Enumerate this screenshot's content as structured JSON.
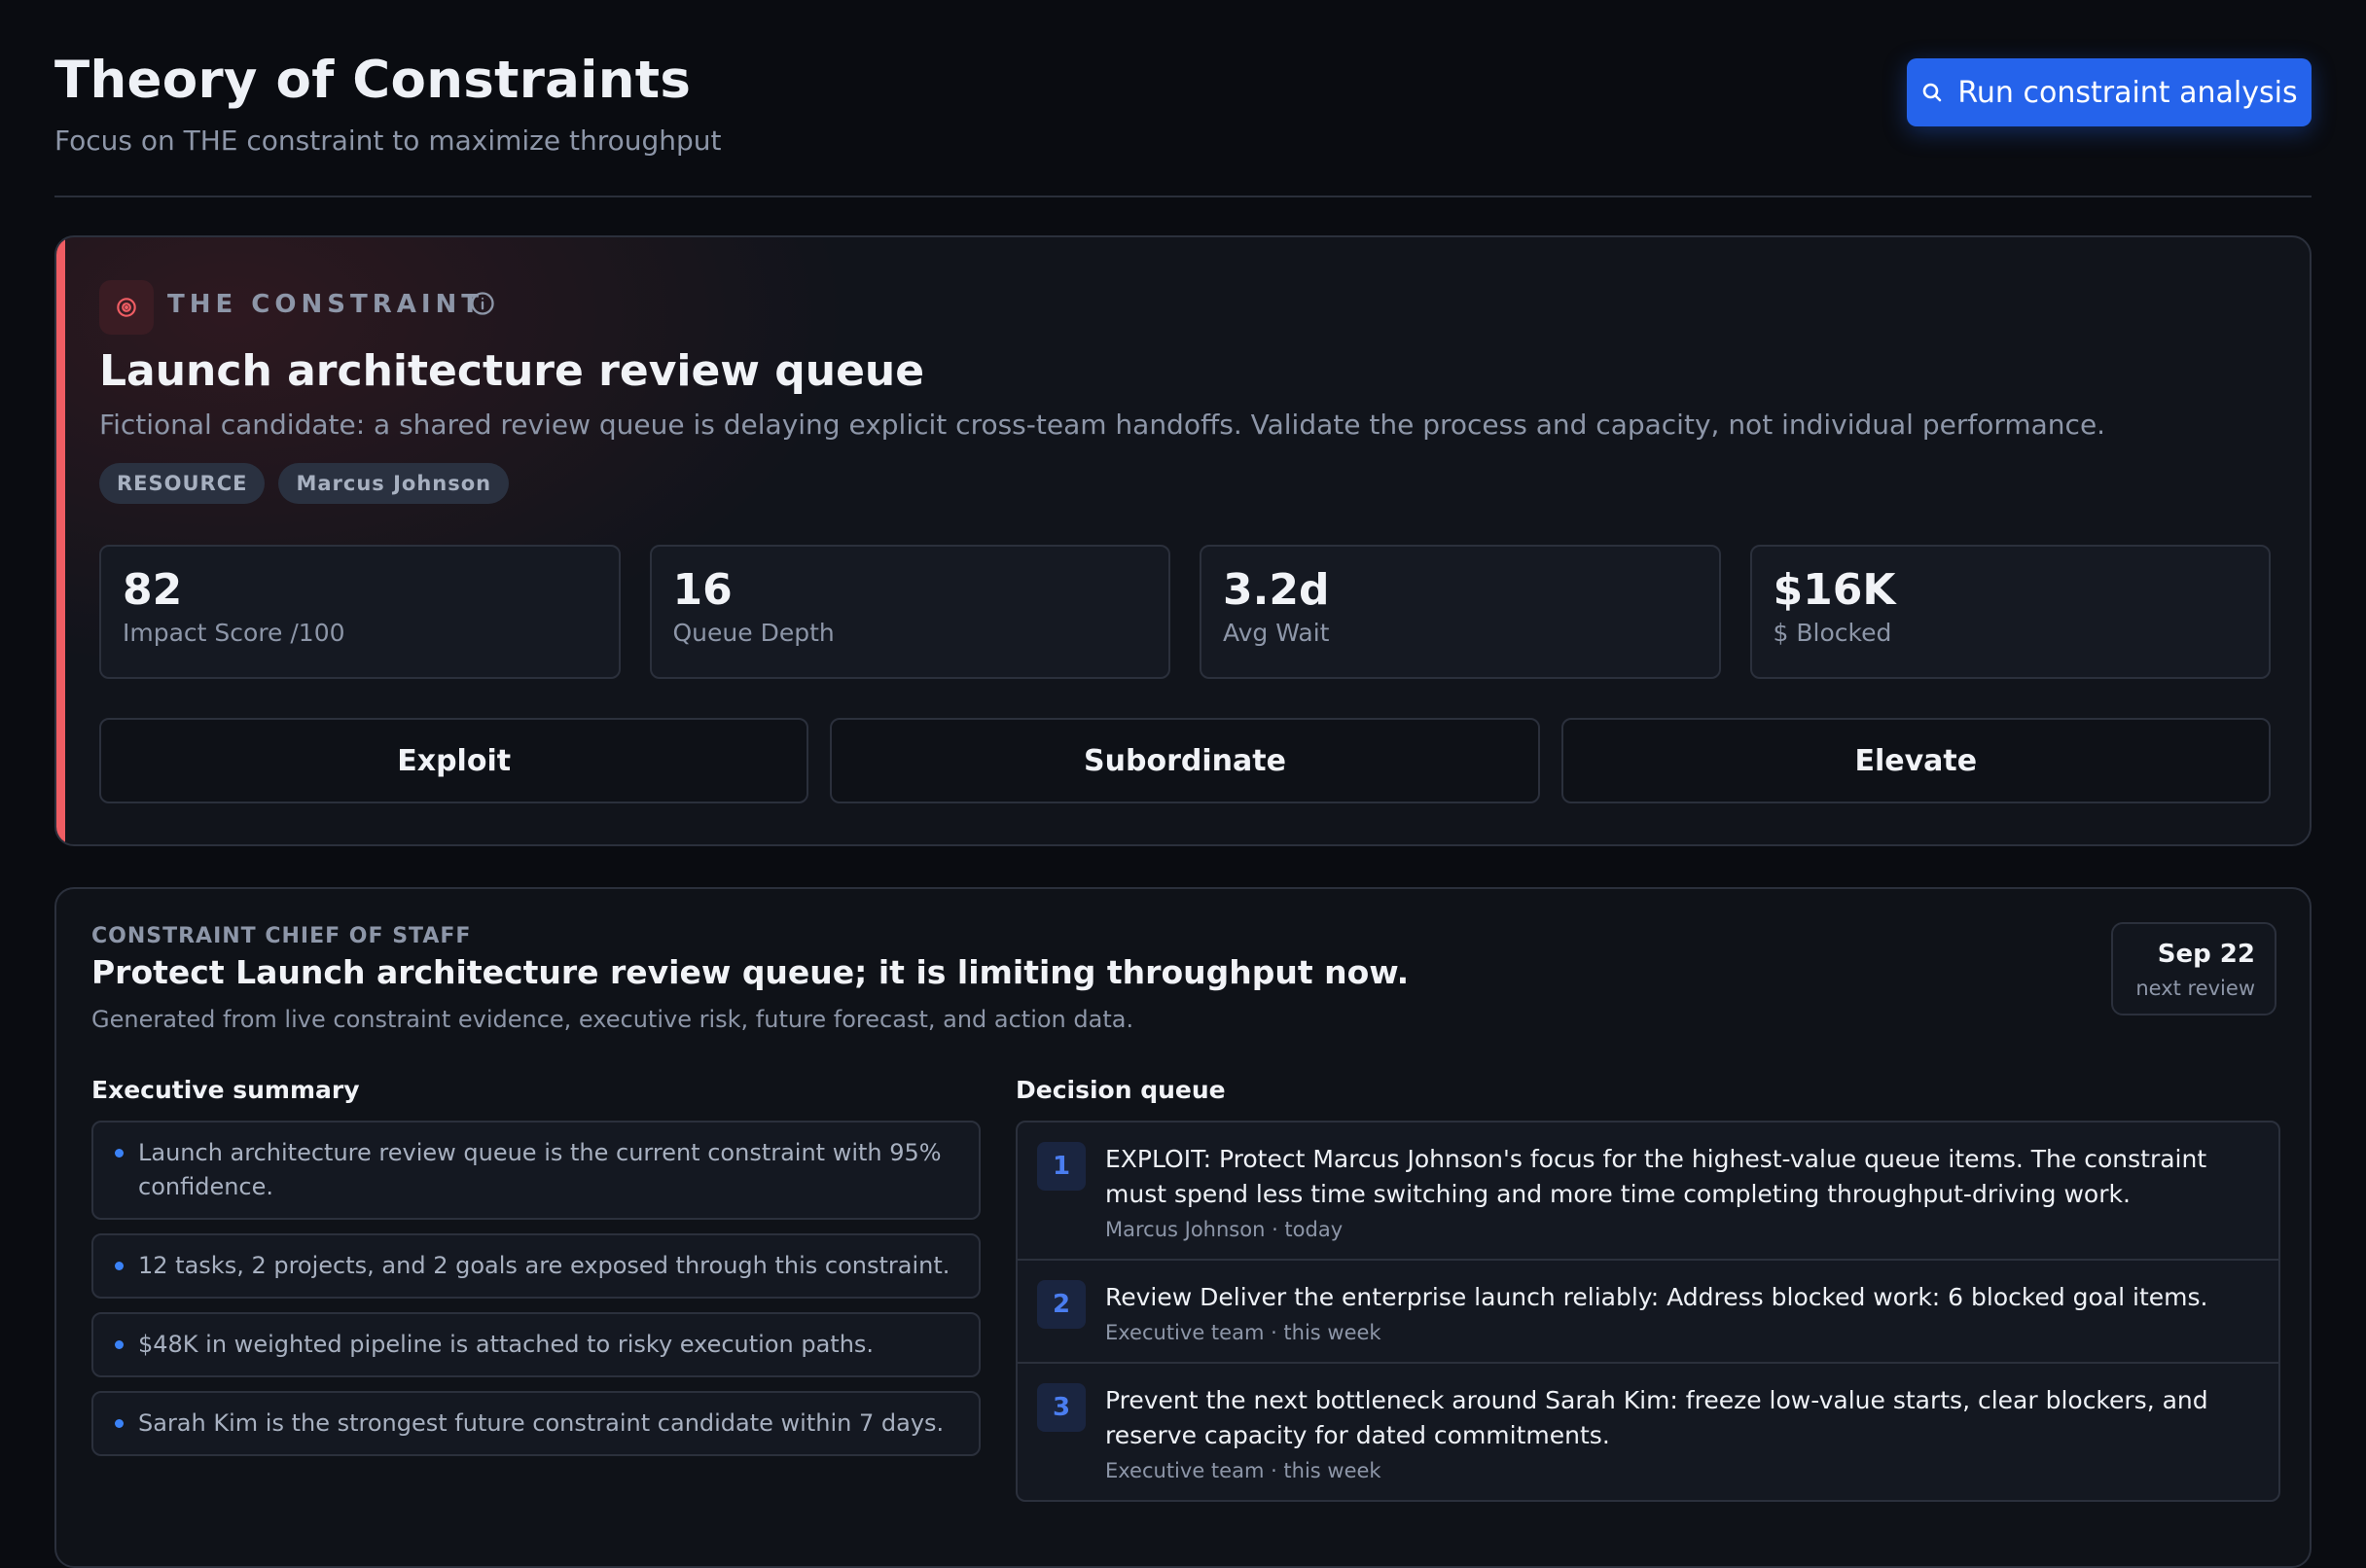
{
  "header": {
    "title": "Theory of Constraints",
    "subtitle": "Focus on THE constraint to maximize throughput",
    "run_button_label": "Run constraint analysis",
    "run_button_icon": "search-icon"
  },
  "constraint": {
    "eyebrow": "THE CONSTRAINT",
    "icon": "target-icon",
    "info_icon": "info-icon",
    "title": "Launch architecture review queue",
    "description": "Fictional candidate: a shared review queue is delaying explicit cross-team handoffs. Validate the process and capacity, not individual performance.",
    "tags": [
      "RESOURCE",
      "Marcus Johnson"
    ],
    "metrics": [
      {
        "value": "82",
        "label": "Impact Score /100"
      },
      {
        "value": "16",
        "label": "Queue Depth"
      },
      {
        "value": "3.2d",
        "label": "Avg Wait"
      },
      {
        "value": "$16K",
        "label": "$ Blocked"
      }
    ],
    "actions": [
      "Exploit",
      "Subordinate",
      "Elevate"
    ],
    "accent_color": "#ef5d63"
  },
  "chief_of_staff": {
    "eyebrow": "CONSTRAINT CHIEF OF STAFF",
    "title": "Protect Launch architecture review queue; it is limiting throughput now.",
    "subtitle": "Generated from live constraint evidence, executive risk, future forecast, and action data.",
    "review_date": "Sep 22",
    "review_label": "next review",
    "summary_heading": "Executive summary",
    "summary": [
      "Launch architecture review queue is the current constraint with 95% confidence.",
      "12 tasks, 2 projects, and 2 goals are exposed through this constraint.",
      "$48K in weighted pipeline is attached to risky execution paths.",
      "Sarah Kim is the strongest future constraint candidate within 7 days."
    ],
    "decision_heading": "Decision queue",
    "decisions": [
      {
        "num": "1",
        "text": "EXPLOIT: Protect Marcus Johnson's focus for the highest-value queue items. The constraint must spend less time switching and more time completing throughput-driving work.",
        "meta": "Marcus Johnson · today"
      },
      {
        "num": "2",
        "text": "Review Deliver the enterprise launch reliably: Address blocked work: 6 blocked goal items.",
        "meta": "Executive team · this week"
      },
      {
        "num": "3",
        "text": "Prevent the next bottleneck around Sarah Kim: freeze low-value starts, clear blockers, and reserve capacity for dated commitments.",
        "meta": "Executive team · this week"
      }
    ]
  },
  "colors": {
    "background": "#0a0c11",
    "primary": "#2563eb",
    "accent_red": "#ef5d63"
  }
}
